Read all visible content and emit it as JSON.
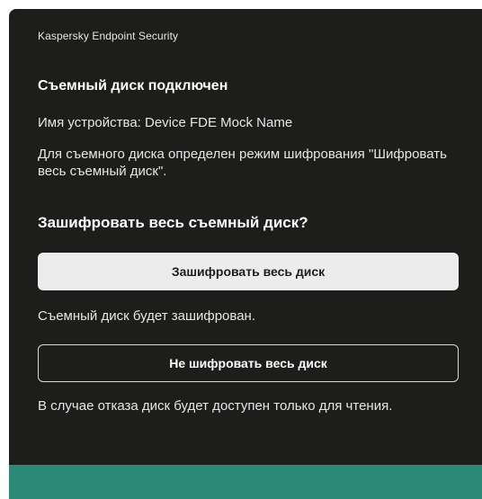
{
  "window": {
    "app_title": "Kaspersky Endpoint Security"
  },
  "notification": {
    "heading": "Съемный диск подключен",
    "device_name": "Имя устройства: Device FDE Mock Name",
    "mode_text": "Для съемного диска определен режим шифрования \"Шифровать весь съемный диск\".",
    "question": "Зашифровать весь съемный диск?"
  },
  "actions": {
    "encrypt_label": "Зашифровать весь диск",
    "encrypt_note": "Съемный диск будет зашифрован.",
    "skip_label": "Не шифровать весь диск",
    "skip_note": "В случае отказа диск будет доступен только для чтения."
  },
  "colors": {
    "background": "#1d1d1b",
    "accent": "#2a8a75",
    "primary_button": "#ececec"
  }
}
